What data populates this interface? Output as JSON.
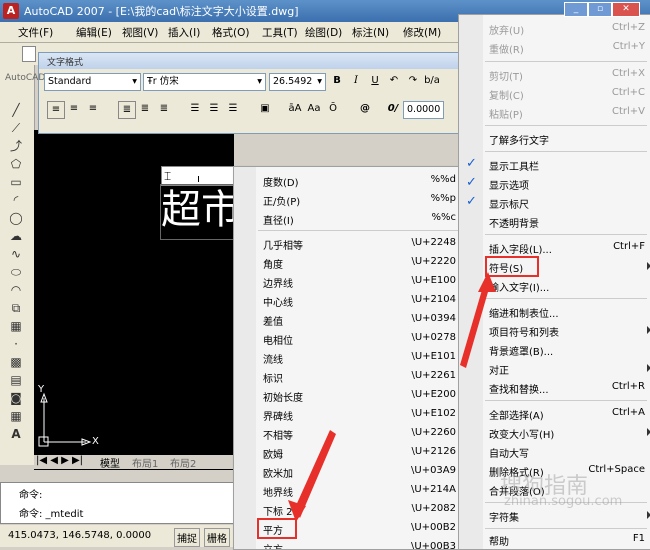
{
  "window": {
    "title": "AutoCAD 2007 - [E:\\我的cad\\标注文字大小设置.dwg]",
    "app_icon": "A"
  },
  "menubar": {
    "items": [
      "文件(F)",
      "编辑(E)",
      "视图(V)",
      "插入(I)",
      "格式(O)",
      "工具(T)",
      "绘图(D)",
      "标注(N)",
      "修改(M)"
    ]
  },
  "textfmt": {
    "title": "文字格式",
    "style": "Standard",
    "font": "仿宋",
    "height": "26.5492",
    "bold": "B",
    "italic": "I",
    "underline": "U",
    "oblique_label": "0/",
    "oblique_value": "0.0000",
    "font_prefix": "Ŧr",
    "at": "@",
    "style_label": "AutoCAD"
  },
  "drawing": {
    "text": "超市",
    "axis_x": "X",
    "axis_y": "Y"
  },
  "tabs": [
    "模型",
    "布局1",
    "布局2"
  ],
  "command": {
    "line1": "命令:",
    "line2": "命令: _mtedit"
  },
  "status": {
    "coords": "415.0473, 146.5748, 0.0000",
    "btn1": "捕捉",
    "btn2": "栅格"
  },
  "symbol_menu": {
    "items": [
      {
        "label": "度数(D)",
        "code": "%%d"
      },
      {
        "label": "正/负(P)",
        "code": "%%p"
      },
      {
        "label": "直径(I)",
        "code": "%%c"
      },
      {
        "label": "几乎相等",
        "code": "\\U+2248"
      },
      {
        "label": "角度",
        "code": "\\U+2220"
      },
      {
        "label": "边界线",
        "code": "\\U+E100"
      },
      {
        "label": "中心线",
        "code": "\\U+2104"
      },
      {
        "label": "差值",
        "code": "\\U+0394"
      },
      {
        "label": "电相位",
        "code": "\\U+0278"
      },
      {
        "label": "流线",
        "code": "\\U+E101"
      },
      {
        "label": "标识",
        "code": "\\U+2261"
      },
      {
        "label": "初始长度",
        "code": "\\U+E200"
      },
      {
        "label": "界碑线",
        "code": "\\U+E102"
      },
      {
        "label": "不相等",
        "code": "\\U+2260"
      },
      {
        "label": "欧姆",
        "code": "\\U+2126"
      },
      {
        "label": "欧米加",
        "code": "\\U+03A9"
      },
      {
        "label": "地界线",
        "code": "\\U+214A"
      },
      {
        "label": "下标 2",
        "code": "\\U+2082"
      },
      {
        "label": "平方",
        "code": "\\U+00B2"
      },
      {
        "label": "立方",
        "code": "\\U+00B3"
      }
    ]
  },
  "context_menu": {
    "items": [
      {
        "label": "放弃(U)",
        "shortcut": "Ctrl+Z",
        "disabled": true
      },
      {
        "label": "重做(R)",
        "shortcut": "Ctrl+Y",
        "disabled": true
      },
      {
        "label": "剪切(T)",
        "shortcut": "Ctrl+X",
        "disabled": true
      },
      {
        "label": "复制(C)",
        "shortcut": "Ctrl+C",
        "disabled": true
      },
      {
        "label": "粘贴(P)",
        "shortcut": "Ctrl+V",
        "disabled": true
      },
      {
        "label": "了解多行文字",
        "shortcut": ""
      },
      {
        "label": "显示工具栏",
        "shortcut": "",
        "checked": true
      },
      {
        "label": "显示选项",
        "shortcut": "",
        "checked": true
      },
      {
        "label": "显示标尺",
        "shortcut": "",
        "checked": true
      },
      {
        "label": "不透明背景",
        "shortcut": ""
      },
      {
        "label": "插入字段(L)...",
        "shortcut": "Ctrl+F"
      },
      {
        "label": "符号(S)",
        "shortcut": "",
        "submenu": true
      },
      {
        "label": "输入文字(I)...",
        "shortcut": ""
      },
      {
        "label": "缩进和制表位...",
        "shortcut": ""
      },
      {
        "label": "项目符号和列表",
        "shortcut": "",
        "submenu": true
      },
      {
        "label": "背景遮罩(B)...",
        "shortcut": ""
      },
      {
        "label": "对正",
        "shortcut": "",
        "submenu": true
      },
      {
        "label": "查找和替换...",
        "shortcut": "Ctrl+R"
      },
      {
        "label": "全部选择(A)",
        "shortcut": "Ctrl+A"
      },
      {
        "label": "改变大小写(H)",
        "shortcut": "",
        "submenu": true
      },
      {
        "label": "自动大写",
        "shortcut": ""
      },
      {
        "label": "删除格式(R)",
        "shortcut": "Ctrl+Space"
      },
      {
        "label": "合并段落(O)",
        "shortcut": ""
      },
      {
        "label": "字符集",
        "shortcut": "",
        "submenu": true
      },
      {
        "label": "帮助",
        "shortcut": "F1"
      }
    ]
  },
  "watermark": {
    "line1": "搜狗指南",
    "line2": "zhinan.sogou.com"
  },
  "colors": {
    "highlight": "#e8302a",
    "titlebar": "#3b6fae"
  }
}
